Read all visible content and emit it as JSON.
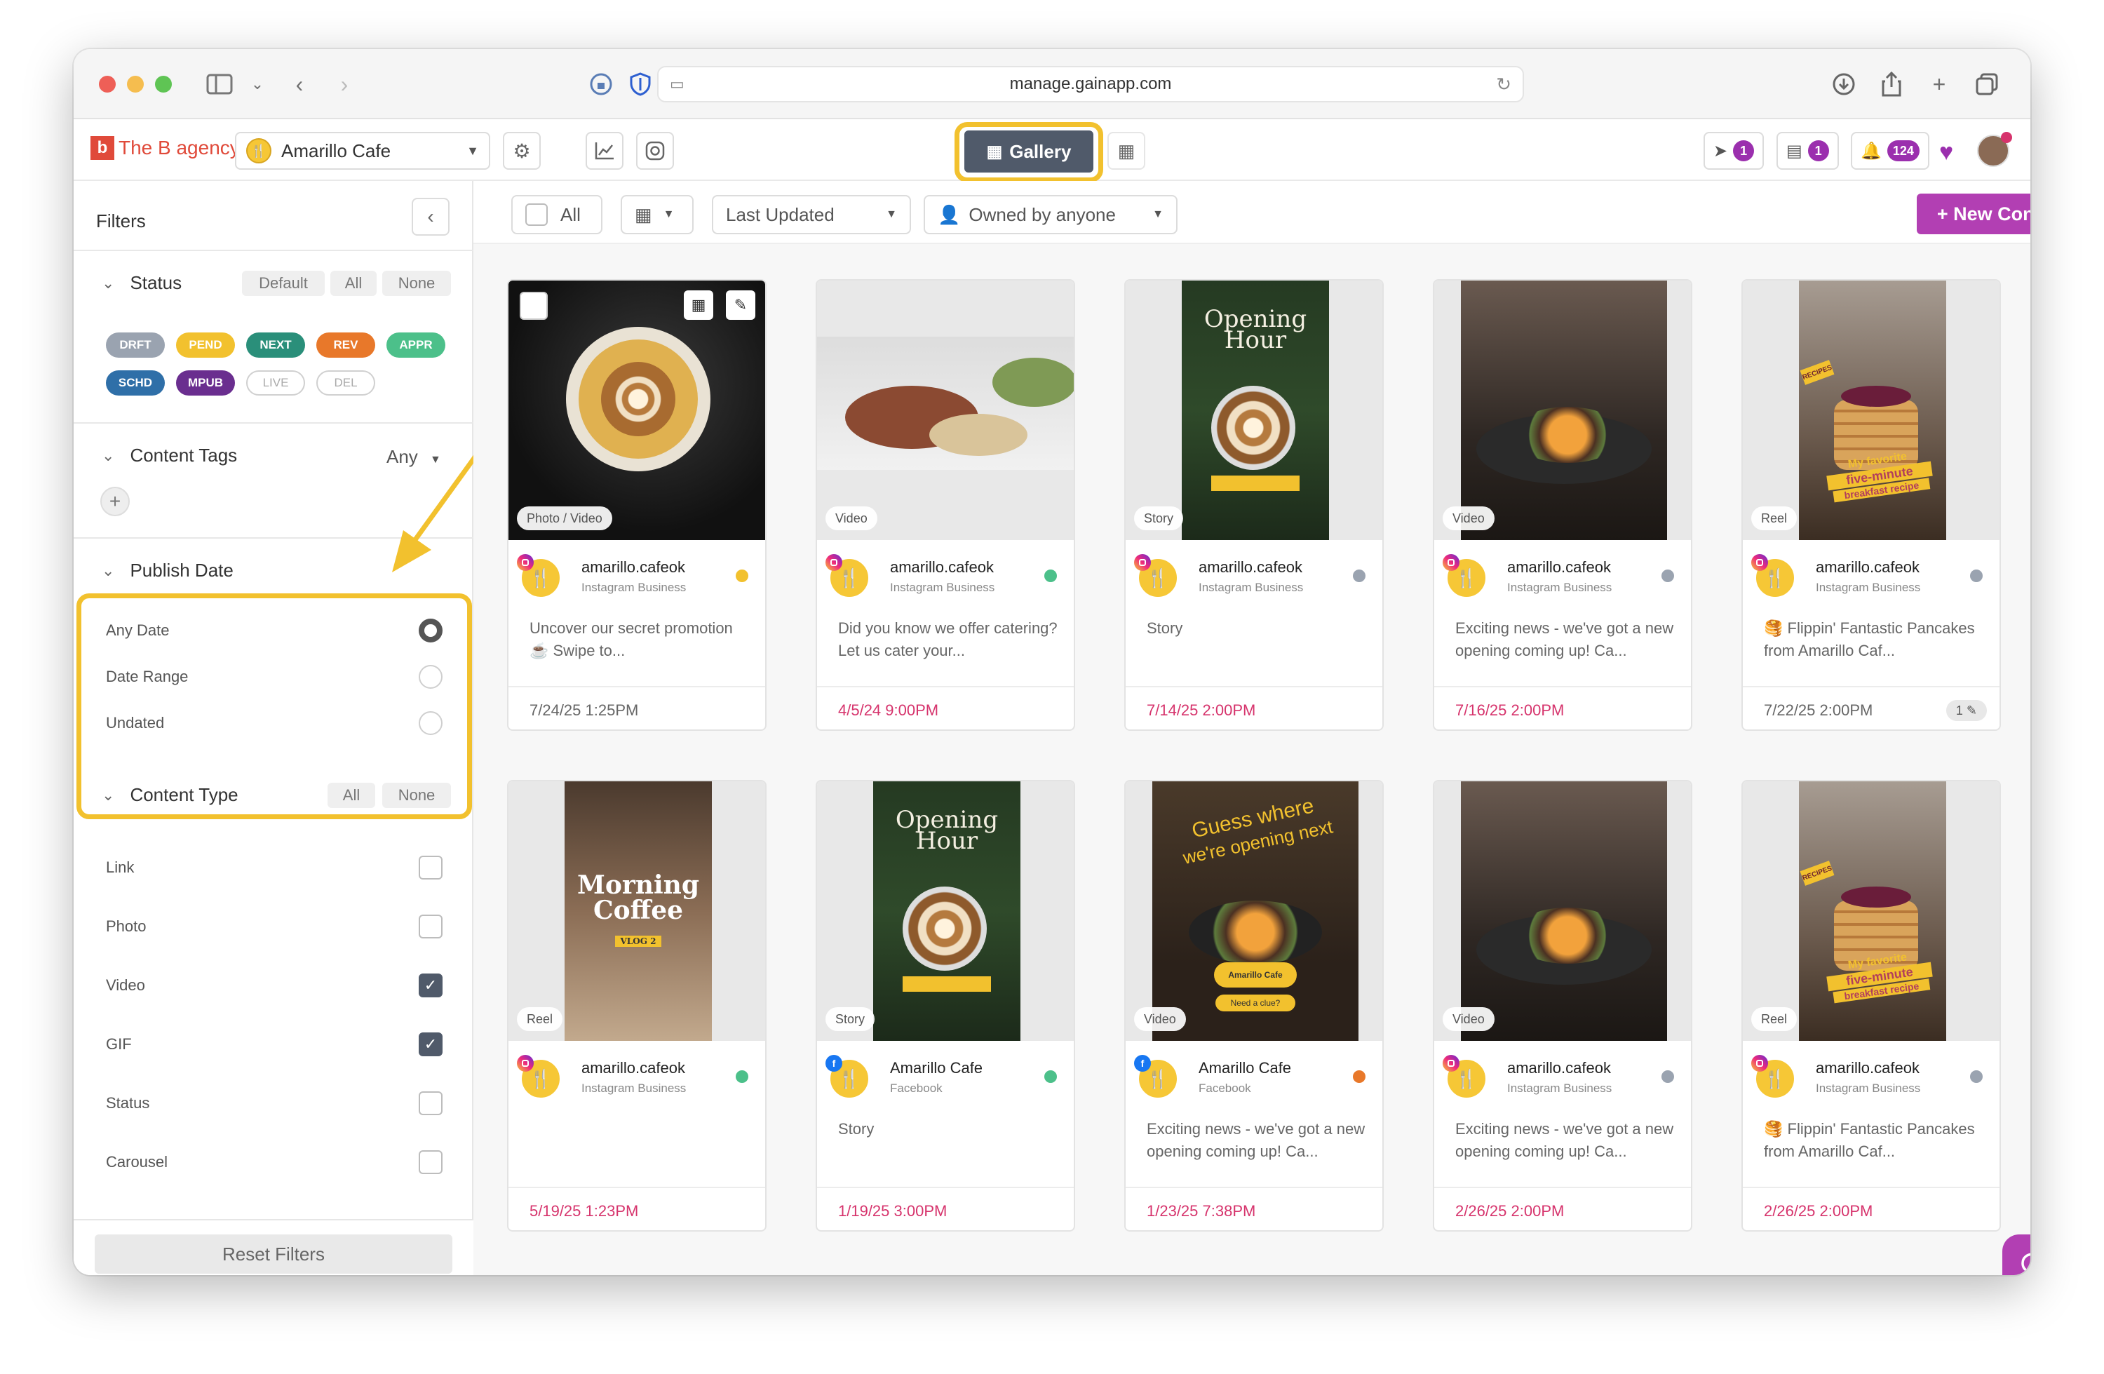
{
  "browser": {
    "url": "manage.gainapp.com"
  },
  "header": {
    "agency_name": "The B agency",
    "agency_logo": "b",
    "workspace": "Amarillo Cafe",
    "gallery_label": "Gallery",
    "approvals_count": "1",
    "tasks_count": "1",
    "notifications_count": "124"
  },
  "sidebar": {
    "title": "Filters",
    "status": {
      "label": "Status",
      "presets": [
        "Default",
        "All",
        "None"
      ],
      "chips": [
        {
          "label": "DRFT",
          "color": "#9aa3b0"
        },
        {
          "label": "PEND",
          "color": "#f2c12e"
        },
        {
          "label": "NEXT",
          "color": "#2a8f7a"
        },
        {
          "label": "REV",
          "color": "#e8782a"
        },
        {
          "label": "APPR",
          "color": "#4cc08a"
        },
        {
          "label": "SCHD",
          "color": "#2f6fa8"
        },
        {
          "label": "MPUB",
          "color": "#6a2e8f"
        },
        {
          "label": "LIVE",
          "color": "outline"
        },
        {
          "label": "DEL",
          "color": "outline"
        }
      ]
    },
    "content_tags": {
      "label": "Content Tags",
      "value": "Any"
    },
    "publish_date": {
      "label": "Publish Date",
      "options": [
        {
          "label": "Any Date",
          "selected": true
        },
        {
          "label": "Date Range",
          "selected": false
        },
        {
          "label": "Undated",
          "selected": false
        }
      ]
    },
    "content_type": {
      "label": "Content Type",
      "presets": [
        "All",
        "None"
      ],
      "options": [
        {
          "label": "Link",
          "checked": false
        },
        {
          "label": "Photo",
          "checked": false
        },
        {
          "label": "Video",
          "checked": true
        },
        {
          "label": "GIF",
          "checked": true
        },
        {
          "label": "Status",
          "checked": false
        },
        {
          "label": "Carousel",
          "checked": false
        }
      ]
    },
    "reset_label": "Reset Filters"
  },
  "toolbar": {
    "all_label": "All",
    "sort_label": "Last Updated",
    "owner_label": "Owned by anyone",
    "new_content_label": "+ New Content"
  },
  "cards": [
    {
      "type": "Photo / Video",
      "network": "instagram",
      "account": "amarillo.cafeok",
      "account_type": "Instagram Business",
      "status_color": "#f2c12e",
      "caption": "Uncover our secret promotion ☕ Swipe to...",
      "date": "7/24/25 1:25PM",
      "date_style": "past",
      "badge": "",
      "img": "coffee"
    },
    {
      "type": "Video",
      "network": "instagram",
      "account": "amarillo.cafeok",
      "account_type": "Instagram Business",
      "status_color": "#4cc08a",
      "caption": "Did you know we offer catering? Let us cater your...",
      "date": "4/5/24 9:00PM",
      "date_style": "red",
      "badge": "",
      "img": "catering"
    },
    {
      "type": "Story",
      "network": "instagram",
      "account": "amarillo.cafeok",
      "account_type": "Instagram Business",
      "status_color": "#9aa3b0",
      "caption": "Story",
      "date": "7/14/25 2:00PM",
      "date_style": "red",
      "badge": "",
      "img": "opening"
    },
    {
      "type": "Video",
      "network": "instagram",
      "account": "amarillo.cafeok",
      "account_type": "Instagram Business",
      "status_color": "#9aa3b0",
      "caption": "Exciting news - we've got a new opening coming up! Ca...",
      "date": "7/16/25 2:00PM",
      "date_style": "red",
      "badge": "",
      "img": "dish"
    },
    {
      "type": "Reel",
      "network": "instagram",
      "account": "amarillo.cafeok",
      "account_type": "Instagram Business",
      "status_color": "#9aa3b0",
      "caption": "🥞 Flippin' Fantastic Pancakes from Amarillo Caf...",
      "date": "7/22/25 2:00PM",
      "date_style": "past",
      "badge": "1 ✎",
      "img": "pancake"
    },
    {
      "type": "Reel",
      "network": "instagram",
      "account": "amarillo.cafeok",
      "account_type": "Instagram Business",
      "status_color": "#4cc08a",
      "caption": "",
      "date": "5/19/25 1:23PM",
      "date_style": "red",
      "badge": "",
      "img": "morning"
    },
    {
      "type": "Story",
      "network": "facebook",
      "account": "Amarillo Cafe",
      "account_type": "Facebook",
      "status_color": "#4cc08a",
      "caption": "Story",
      "date": "1/19/25 3:00PM",
      "date_style": "red",
      "badge": "",
      "img": "opening"
    },
    {
      "type": "Video",
      "network": "facebook",
      "account": "Amarillo Cafe",
      "account_type": "Facebook",
      "status_color": "#e8782a",
      "caption": "Exciting news - we've got a new opening coming up! Ca...",
      "date": "1/23/25 7:38PM",
      "date_style": "red",
      "badge": "",
      "img": "guess"
    },
    {
      "type": "Video",
      "network": "instagram",
      "account": "amarillo.cafeok",
      "account_type": "Instagram Business",
      "status_color": "#9aa3b0",
      "caption": "Exciting news - we've got a new opening coming up! Ca...",
      "date": "2/26/25 2:00PM",
      "date_style": "red",
      "badge": "",
      "img": "dish"
    },
    {
      "type": "Reel",
      "network": "instagram",
      "account": "amarillo.cafeok",
      "account_type": "Instagram Business",
      "status_color": "#9aa3b0",
      "caption": "🥞 Flippin' Fantastic Pancakes from Amarillo Caf...",
      "date": "2/26/25 2:00PM",
      "date_style": "red",
      "badge": "",
      "img": "pancake"
    }
  ],
  "image_text": {
    "opening": [
      "Opening",
      "Hour"
    ],
    "morning": [
      "Morning",
      "Coffee",
      "VLOG 2"
    ],
    "guess": [
      "Guess where",
      "we're opening next",
      "Amarillo Cafe",
      "Need a clue?"
    ],
    "pancake": [
      "RECIPES",
      "My favorite",
      "five-minute",
      "breakfast recipe"
    ]
  }
}
